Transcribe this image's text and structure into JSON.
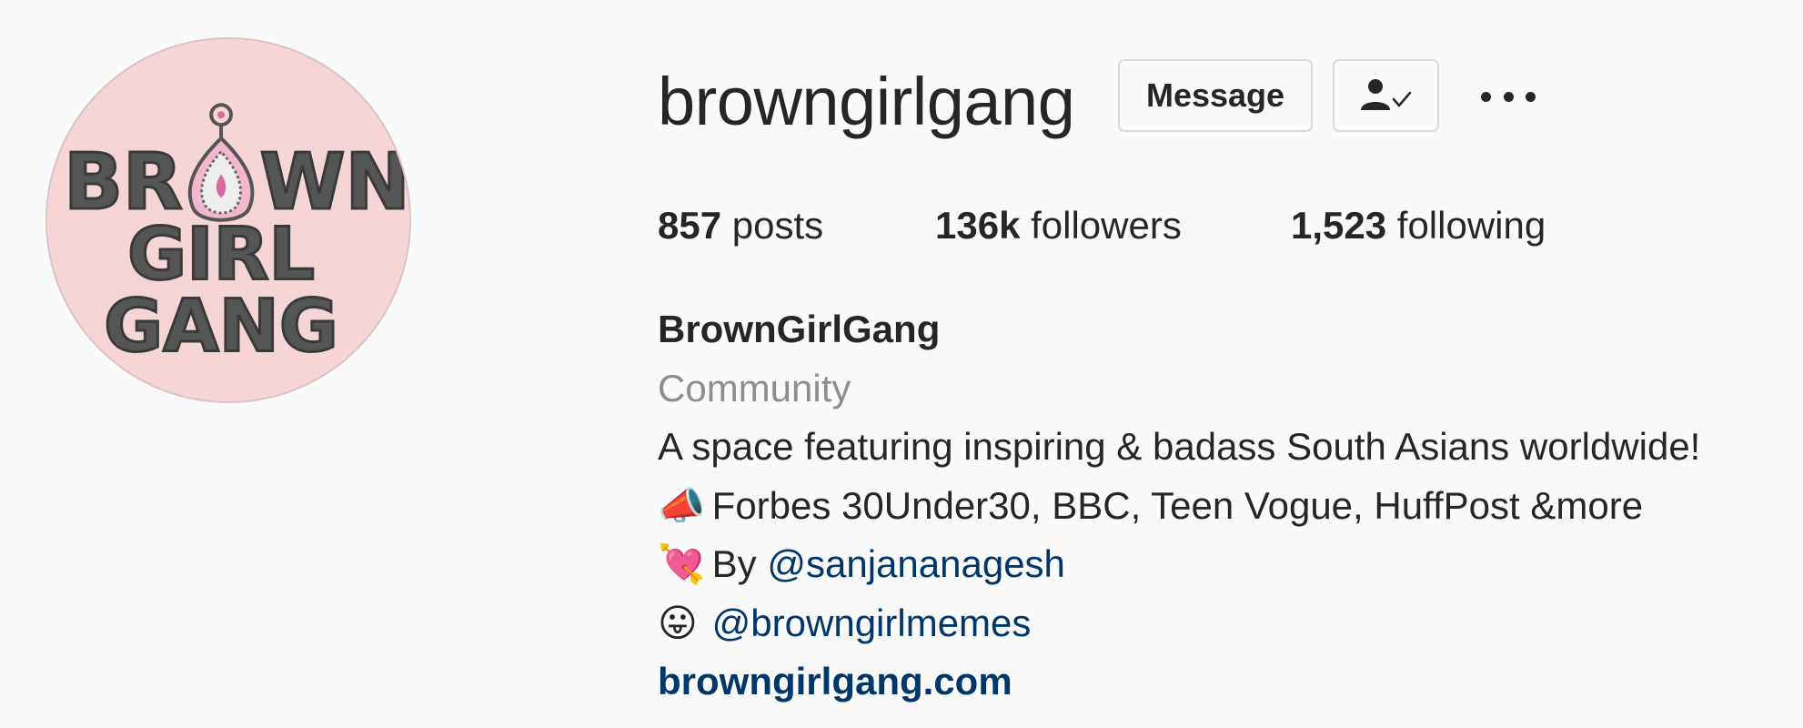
{
  "profile": {
    "avatar_text": [
      "BR",
      "WN",
      "GIRL",
      "GANG"
    ],
    "username": "browngirlgang",
    "message_label": "Message",
    "follow_icon": "person-check-icon",
    "more_icon": "more-horizontal-icon"
  },
  "stats": {
    "posts_count": "857",
    "posts_label": "posts",
    "followers_count": "136k",
    "followers_label": "followers",
    "following_count": "1,523",
    "following_label": "following"
  },
  "bio": {
    "full_name": "BrownGirlGang",
    "category": "Community",
    "line1": "A space featuring inspiring & badass South Asians worldwide!",
    "line2_emoji": "📣",
    "line2_text": "Forbes 30Under30, BBC, Teen Vogue, HuffPost &more",
    "line3_emoji": "💘",
    "line3_prefix": "By",
    "line3_mention": "@sanjananagesh",
    "line4_emoji": "😛",
    "line4_mention": "@browngirlmemes",
    "website": "browngirlgang.com"
  },
  "colors": {
    "background": "#fafafa",
    "text": "#262626",
    "secondary": "#8e8e8e",
    "link": "#00376b",
    "avatar_bg": "#f6d5d6"
  }
}
